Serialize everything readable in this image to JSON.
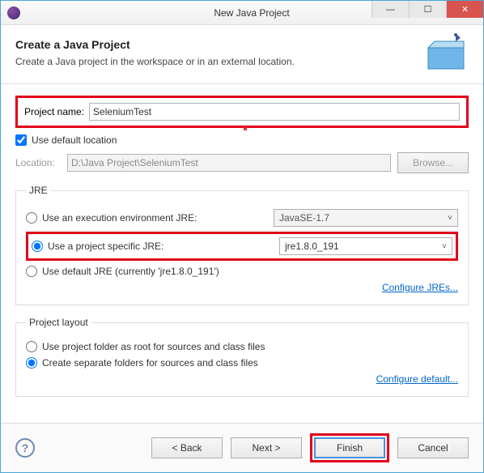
{
  "window": {
    "title": "New Java Project"
  },
  "header": {
    "title": "Create a Java Project",
    "subtitle": "Create a Java project in the workspace or in an external location."
  },
  "project": {
    "name_label": "Project name:",
    "name_value": "SeleniumTest",
    "use_default_label": "Use default location",
    "location_label": "Location:",
    "location_value": "D:\\Java Project\\SeleniumTest",
    "browse_label": "Browse..."
  },
  "jre": {
    "legend": "JRE",
    "opt_exec_env": "Use an execution environment JRE:",
    "exec_env_value": "JavaSE-1.7",
    "opt_specific": "Use a project specific JRE:",
    "specific_value": "jre1.8.0_191",
    "opt_default": "Use default JRE (currently 'jre1.8.0_191')",
    "configure_link": "Configure JREs..."
  },
  "layout": {
    "legend": "Project layout",
    "opt_root": "Use project folder as root for sources and class files",
    "opt_separate": "Create separate folders for sources and class files",
    "configure_link": "Configure default..."
  },
  "buttons": {
    "back": "< Back",
    "next": "Next >",
    "finish": "Finish",
    "cancel": "Cancel"
  },
  "icons": {
    "minimize": "—",
    "maximize": "☐",
    "close": "✕",
    "help": "?",
    "chevron": "˅"
  }
}
